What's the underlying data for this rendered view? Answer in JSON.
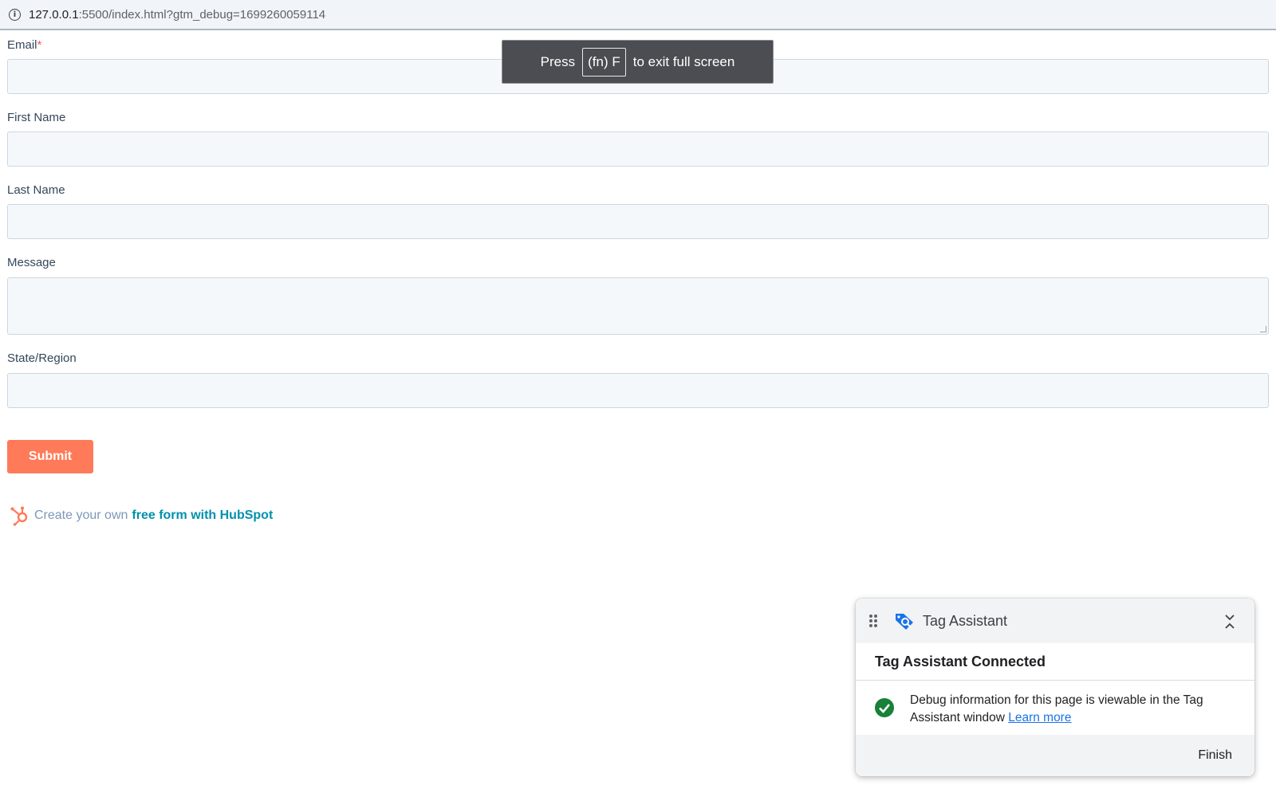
{
  "browser": {
    "url_host": "127.0.0.1",
    "url_rest": ":5500/index.html?gtm_debug=1699260059114"
  },
  "form": {
    "email_label": "Email",
    "required_mark": "*",
    "first_name_label": "First Name",
    "last_name_label": "Last Name",
    "message_label": "Message",
    "state_label": "State/Region",
    "submit_label": "Submit",
    "hubspot_text": "Create your own",
    "hubspot_link": "free form with HubSpot"
  },
  "fullscreen_toast": {
    "press": "Press",
    "key": "(fn) F",
    "suffix": "to exit full screen"
  },
  "tag_assistant": {
    "title": "Tag Assistant",
    "status": "Tag Assistant Connected",
    "message": "Debug information for this page is viewable in the Tag Assistant window",
    "learn_more": "Learn more",
    "finish": "Finish"
  },
  "colors": {
    "submit": "#ff7a59",
    "hubspot_link": "#0091ae",
    "check": "#188038",
    "tag_logo": "#1a73e8"
  },
  "icons": [
    "info-icon",
    "hubspot-sprocket-icon",
    "drag-handle-icon",
    "tag-assistant-logo-icon",
    "collapse-icon",
    "check-circle-icon"
  ]
}
